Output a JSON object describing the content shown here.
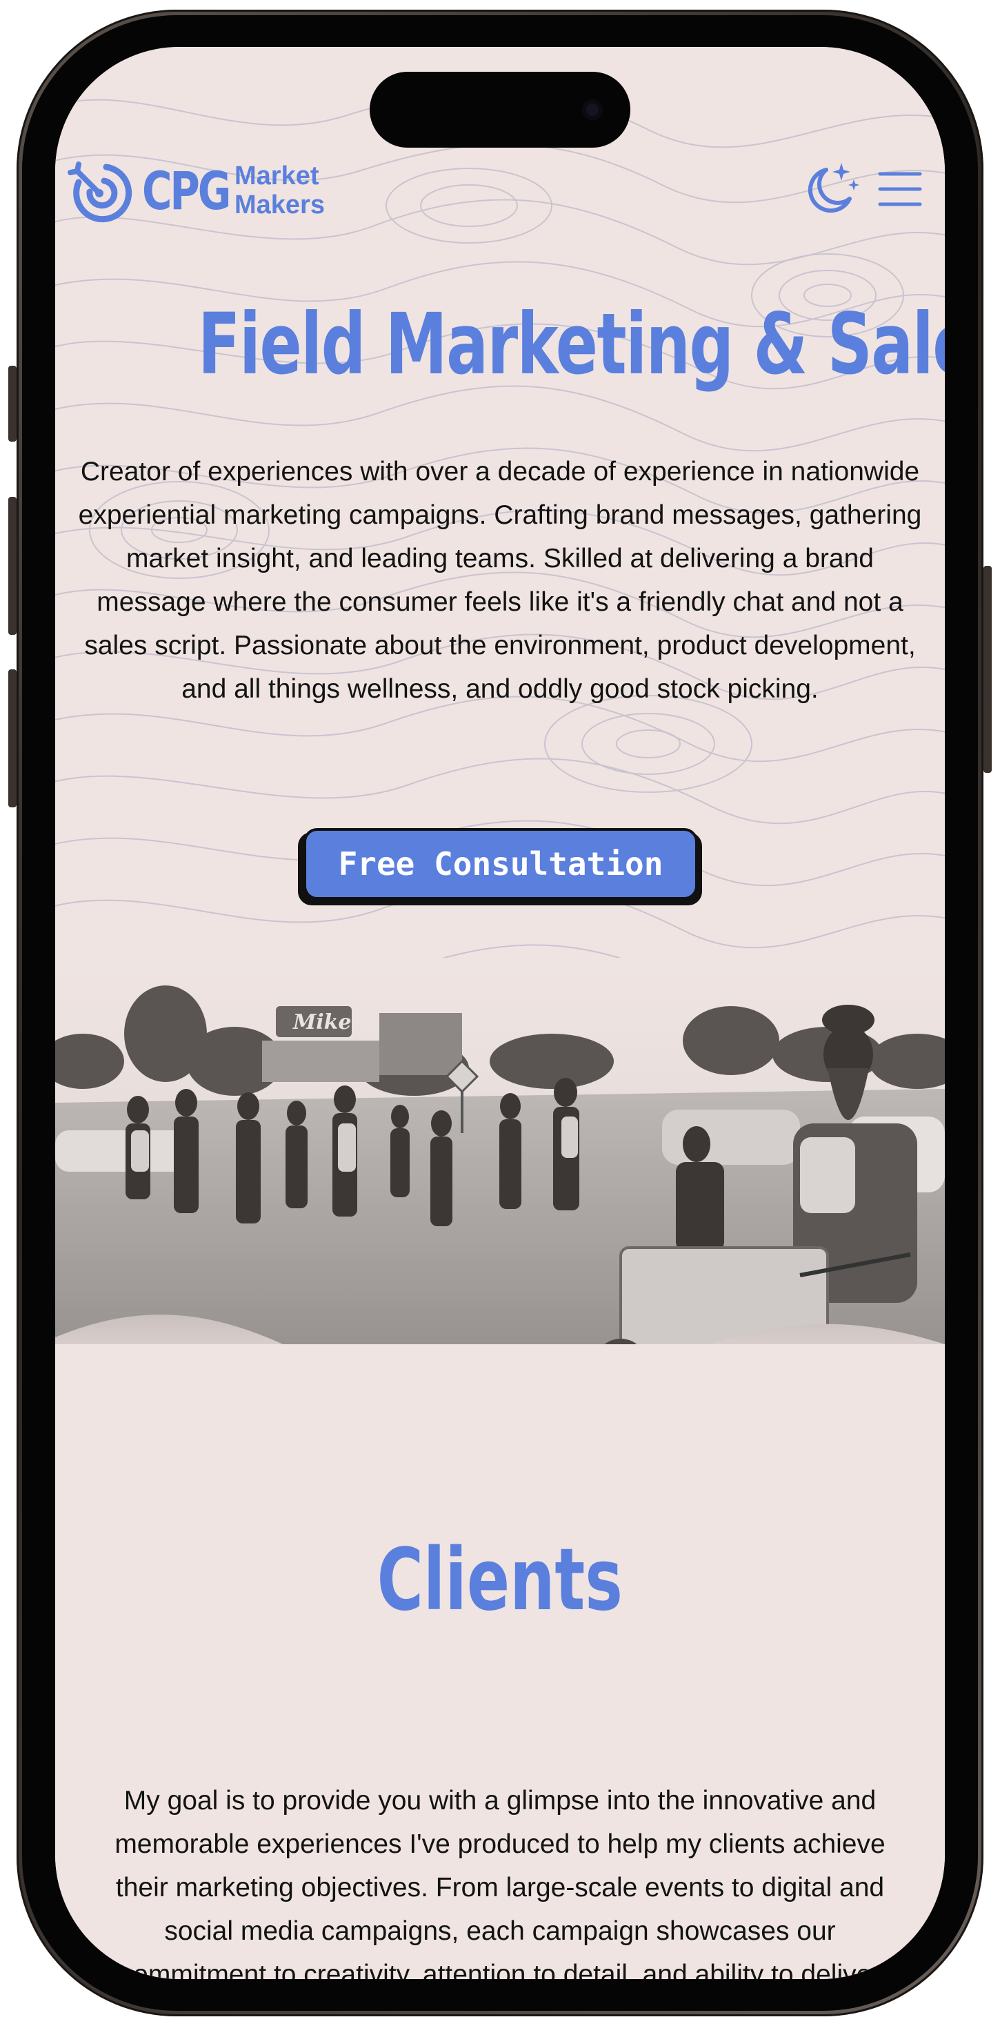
{
  "brand": {
    "abbr": "CPG",
    "line1": "Market",
    "line2": "Makers",
    "accent_color": "#5b7fdd"
  },
  "header": {
    "theme_toggle_icon": "moon-stars-icon",
    "menu_icon": "hamburger-menu-icon"
  },
  "hero": {
    "title": "Field Marketing & Sales",
    "description": "Creator of experiences with over a decade of experience in nationwide experiential marketing campaigns. Crafting brand messages, gathering market insight, and leading teams. Skilled at delivering a brand message where the consumer feels like it's a friendly chat and not a sales script. Passionate about the environment, product development, and all things wellness, and oddly good stock picking.",
    "cta_label": "Free Consultation"
  },
  "photo": {
    "sign_text": "Mike's"
  },
  "clients": {
    "title": "Clients",
    "description": "My goal is to provide you with a glimpse into the innovative and memorable experiences I've produced to help my clients achieve their marketing objectives. From large-scale events to digital and social media campaigns, each campaign showcases our commitment to creativity, attention to detail, and ability to deliver exceptional results."
  }
}
